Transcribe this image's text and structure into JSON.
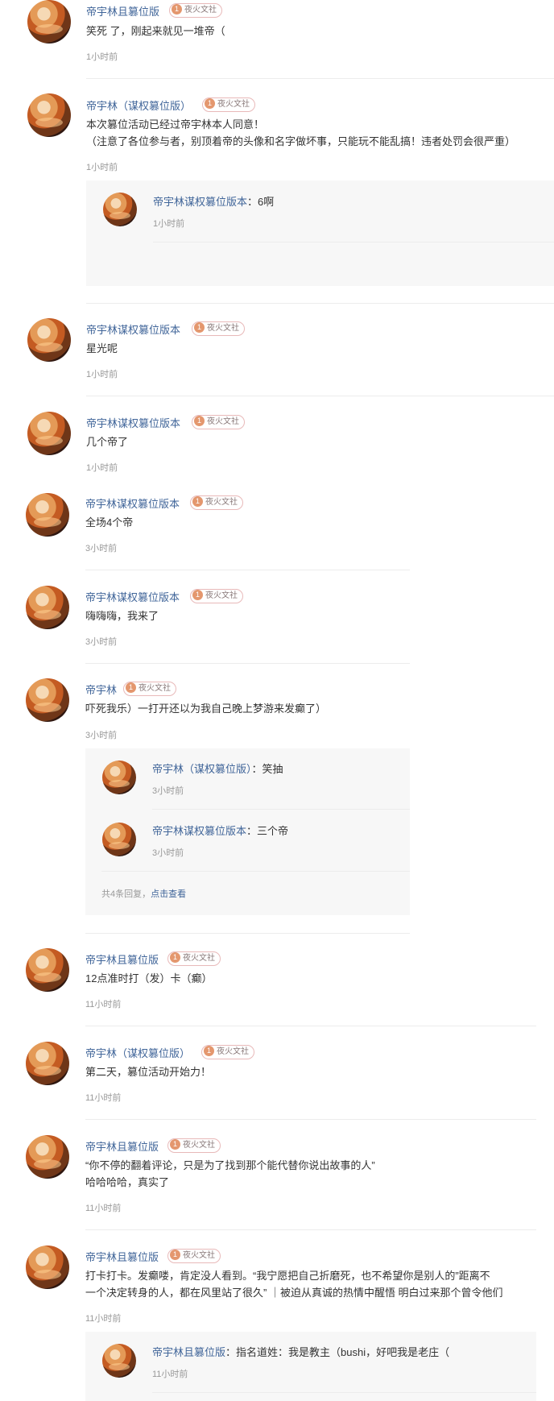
{
  "badge_label": "夜火文社",
  "badge_level": "1",
  "comments": [
    {
      "user": "帝宇林且篡位版",
      "lines": [
        "笑死 了，刚起来就见一堆帝（"
      ],
      "time": "1小时前"
    },
    {
      "user": "帝宇林（谋权篡位版）",
      "lines": [
        "本次篡位活动已经过帝宇林本人同意！",
        "（注意了各位参与者，别顶着帝的头像和名字做坏事，只能玩不能乱搞！违者处罚会很严重）"
      ],
      "time": "1小时前",
      "replies": [
        {
          "user": "帝宇林谋权篡位版本",
          "text": "6啊",
          "time": "1小时前"
        }
      ]
    },
    {
      "user": "帝宇林谋权篡位版本",
      "lines": [
        "星光呢"
      ],
      "time": "1小时前"
    },
    {
      "user": "帝宇林谋权篡位版本",
      "lines": [
        "几个帝了"
      ],
      "time": "1小时前"
    },
    {
      "user": "帝宇林谋权篡位版本",
      "lines": [
        "全场4个帝"
      ],
      "time": "3小时前"
    },
    {
      "user": "帝宇林谋权篡位版本",
      "lines": [
        "嗨嗨嗨，我来了"
      ],
      "time": "3小时前"
    },
    {
      "user": "帝宇林",
      "lines": [
        "吓死我乐）一打开还以为我自己晚上梦游来发癫了）"
      ],
      "time": "3小时前",
      "replies": [
        {
          "user": "帝宇林（谋权篡位版）",
          "text": "笑抽",
          "time": "3小时前"
        },
        {
          "user": "帝宇林谋权篡位版本",
          "text": "三个帝",
          "time": "3小时前"
        }
      ],
      "more_prefix": "共4条回复，",
      "more_link": "点击查看"
    },
    {
      "user": "帝宇林且篡位版",
      "lines": [
        "12点准时打（发）卡（癫）"
      ],
      "time": "11小时前"
    },
    {
      "user": "帝宇林（谋权篡位版）",
      "lines": [
        "第二天，篡位活动开始力！"
      ],
      "time": "11小时前"
    },
    {
      "user": "帝宇林且篡位版",
      "lines": [
        "“你不停的翻着评论，只是为了找到那个能代替你说出故事的人”",
        "哈哈哈哈，真实了"
      ],
      "time": "11小时前"
    },
    {
      "user": "帝宇林且篡位版",
      "lines": [
        "打卡打卡。发癫喽，肯定没人看到。“我宁愿把自己折磨死，也不希望你是别人的”距离不",
        "一个决定转身的人，都在风里站了很久” ｜被迫从真诚的热情中醒悟 明白过来那个曾令他们"
      ],
      "time": "11小时前",
      "replies": [
        {
          "user": "帝宇林且篡位版",
          "text": "指名道姓：我是教主（bushi，好吧我是老庄（",
          "time": "11小时前"
        }
      ]
    }
  ]
}
